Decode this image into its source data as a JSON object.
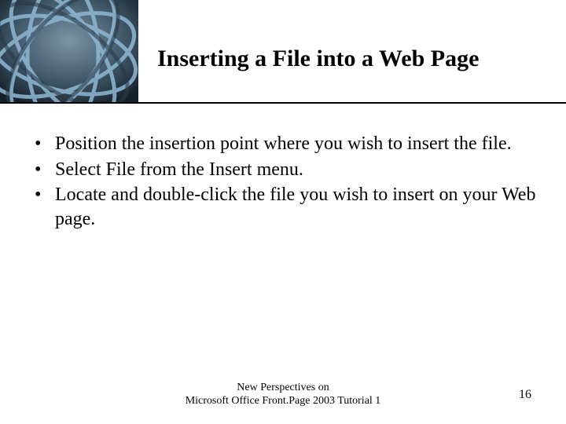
{
  "slide": {
    "title": "Inserting a File into a Web Page",
    "bullets": [
      "Position the insertion point where you wish to insert the file.",
      "Select File from the Insert menu.",
      "Locate and double-click the file you wish to insert on your Web page."
    ],
    "footer_line1": "New Perspectives on",
    "footer_line2": "Microsoft Office Front.Page 2003 Tutorial 1",
    "page_number": "16"
  }
}
